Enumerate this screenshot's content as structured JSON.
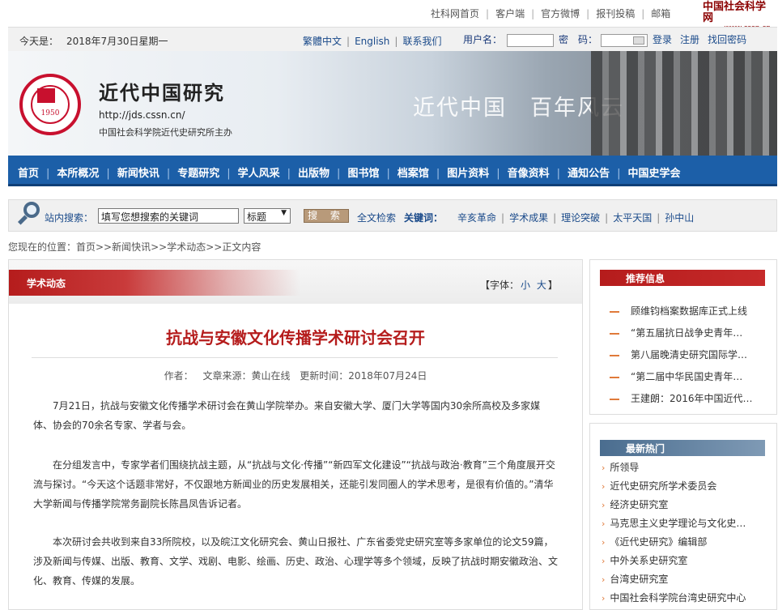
{
  "top_links": {
    "items": [
      "社科网首页",
      "客户端",
      "官方微博",
      "报刊投稿",
      "邮箱"
    ],
    "brand_cn": "中国社会科学网",
    "brand_en": "www.cssn.cn"
  },
  "info_bar": {
    "date_label": "今天是：",
    "date": "2018年7月30日星期一",
    "lang_links": [
      "繁體中文",
      "English",
      "联系我们"
    ],
    "username_label": "用户名：",
    "password_label": "密　码：",
    "login": "登录",
    "register": "注册",
    "forgot": "找回密码"
  },
  "banner": {
    "title": "近代中国研究",
    "url": "http://jds.cssn.cn/",
    "host": "中国社会科学院近代史研究所主办",
    "slogan": "近代中国　百年风云",
    "seal_year": "1950"
  },
  "nav": {
    "items": [
      "首页",
      "本所概况",
      "新闻快讯",
      "专题研究",
      "学人风采",
      "出版物",
      "图书馆",
      "档案馆",
      "图片资料",
      "音像资料",
      "通知公告",
      "中国史学会"
    ]
  },
  "search": {
    "label": "站内搜索：",
    "value": "填写您想搜索的关键词",
    "select_value": "标题",
    "button": "搜 索",
    "fulltext": "全文检索",
    "keywords_label": "关键词：",
    "keywords": [
      "辛亥革命",
      "学术成果",
      "理论突破",
      "太平天国",
      "孙中山"
    ]
  },
  "breadcrumb": "您现在的位置：首页>>新闻快讯>>学术动态>>正文内容",
  "article": {
    "column": "学术动态",
    "font_label": "【字体：",
    "font_small": "小",
    "font_large": "大",
    "font_end": "】",
    "title": "抗战与安徽文化传播学术研讨会召开",
    "author": "作者：",
    "source": "文章来源：黄山在线",
    "updated": "更新时间：2018年07月24日",
    "paragraphs": [
      "7月21日，抗战与安徽文化传播学术研讨会在黄山学院举办。来自安徽大学、厦门大学等国内30余所高校及多家媒体、协会的70余名专家、学者与会。",
      "在分组发言中，专家学者们围绕抗战主题，从“抗战与文化·传播”“新四军文化建设”“抗战与政治·教育”三个角度展开交流与探讨。“今天这个话题非常好，不仅跟地方新闻业的历史发展相关，还能引发同圈人的学术思考，是很有价值的。”清华大学新闻与传播学院常务副院长陈昌凤告诉记者。",
      "本次研讨会共收到来自33所院校，以及皖江文化研究会、黄山日报社、广东省委党史研究室等多家单位的论文59篇，涉及新闻与传媒、出版、教育、文学、戏剧、电影、绘画、历史、政治、心理学等多个领域，反映了抗战时期安徽政治、文化、教育、传媒的发展。"
    ]
  },
  "recommend": {
    "title": "推荐信息",
    "items": [
      "顾维钧档案数据库正式上线",
      "“第五届抗日战争史青年…",
      "第八届晚清史研究国际学…",
      "“第二届中华民国史青年…",
      "王建朗：2016年中国近代…"
    ]
  },
  "hot": {
    "title": "最新热门",
    "items": [
      "所领导",
      "近代史研究所学术委员会",
      "经济史研究室",
      "马克思主义史学理论与文化史…",
      "《近代史研究》编辑部",
      "中外关系史研究室",
      "台湾史研究室",
      "中国社会科学院台湾史研究中心"
    ]
  },
  "colors": {
    "nav_blue": "#1c5fa8",
    "title_red": "#b51c1c",
    "accent_orange": "#e07a3a"
  }
}
